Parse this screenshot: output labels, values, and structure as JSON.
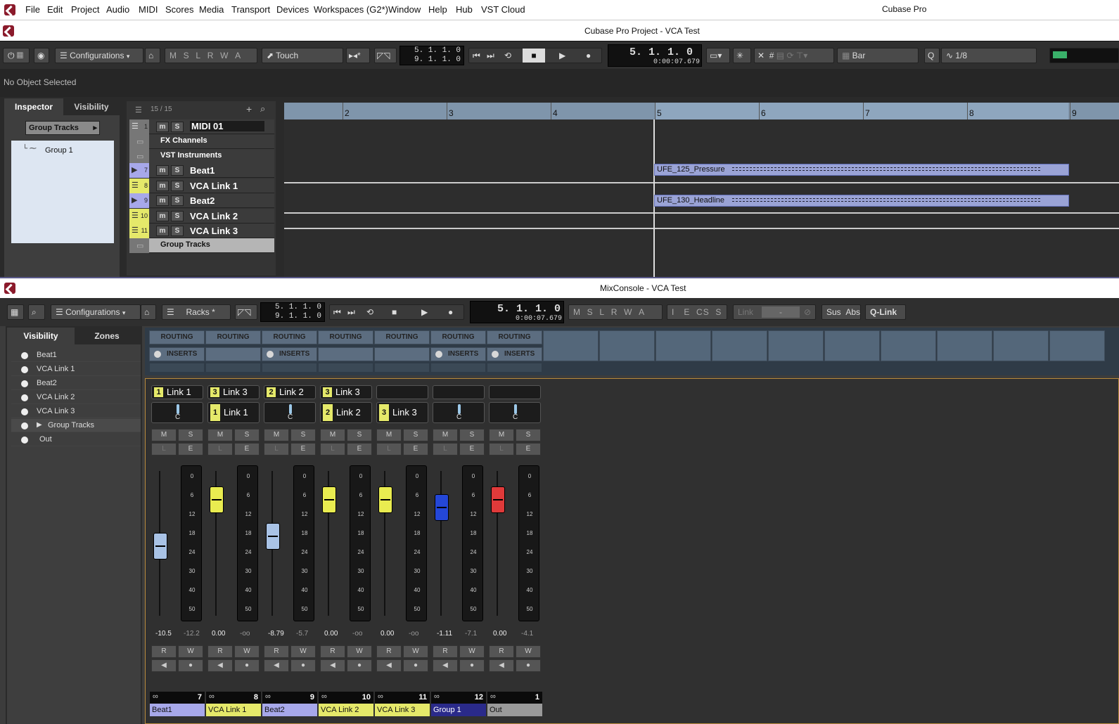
{
  "menu": {
    "items": [
      "File",
      "Edit",
      "Project",
      "Audio",
      "MIDI",
      "Scores",
      "Media",
      "Transport",
      "Devices",
      "Workspaces (G2*)",
      "Window",
      "Help",
      "Hub",
      "VST Cloud"
    ],
    "app": "Cubase Pro"
  },
  "project": {
    "title": "Cubase Pro Project - VCA Test"
  },
  "toolbar": {
    "configurations": "Configurations",
    "mslrwa": [
      "M",
      "S",
      "L",
      "R",
      "W",
      "A"
    ],
    "automation_mode": "Touch",
    "left_locator": "5. 1. 1.   0",
    "right_locator": "9. 1. 1.   0",
    "position_primary": "5.  1.  1.    0",
    "position_secondary": "0:00:07.679",
    "grid": "Bar",
    "quantize": "1/8"
  },
  "infoline": {
    "text": "No Object Selected"
  },
  "inspector": {
    "tabs": [
      "Inspector",
      "Visibility"
    ],
    "section": "Group Tracks",
    "item": "Group 1"
  },
  "tracklist": {
    "count": "15 / 15",
    "tracks": [
      {
        "num": "1",
        "name": "MIDI 01",
        "type": "midi"
      },
      {
        "num": "",
        "name": "FX Channels",
        "type": "folder"
      },
      {
        "num": "",
        "name": "VST Instruments",
        "type": "folder"
      },
      {
        "num": "7",
        "name": "Beat1",
        "type": "audio"
      },
      {
        "num": "8",
        "name": "VCA Link 1",
        "type": "vca"
      },
      {
        "num": "9",
        "name": "Beat2",
        "type": "audio"
      },
      {
        "num": "10",
        "name": "VCA Link 2",
        "type": "vca"
      },
      {
        "num": "11",
        "name": "VCA Link 3",
        "type": "vca"
      },
      {
        "num": "",
        "name": "Group Tracks",
        "type": "folder"
      }
    ]
  },
  "ruler": {
    "bars": [
      "2",
      "3",
      "4",
      "5",
      "6",
      "7",
      "8",
      "9"
    ]
  },
  "events": [
    {
      "name": "UFE_125_Pressure"
    },
    {
      "name": "UFE_130_Headline"
    }
  ],
  "mixconsole": {
    "title": "MixConsole - VCA Test",
    "configurations": "Configurations",
    "racks": "Racks",
    "left_locator": "5. 1. 1.   0",
    "right_locator": "9. 1. 1.   0",
    "position_primary": "5.  1.  1.    0",
    "position_secondary": "0:00:07.679",
    "buttons": [
      "M",
      "S",
      "L",
      "R",
      "W",
      "A"
    ],
    "buttons2": [
      "I",
      "E",
      "CS",
      "S"
    ],
    "link": "Link",
    "link_value": "-",
    "sus": "Sus",
    "abs": "Abs",
    "qlink": "Q-Link"
  },
  "visibility": {
    "tabs": [
      "Visibility",
      "Zones"
    ],
    "items": [
      "Beat1",
      "VCA Link 1",
      "Beat2",
      "VCA Link 2",
      "VCA Link 3",
      "Group Tracks",
      "Out"
    ]
  },
  "racks": {
    "routing": "ROUTING",
    "inserts": "INSERTS"
  },
  "meter_scale": [
    "0",
    "6",
    "12",
    "18",
    "24",
    "30",
    "40",
    "50"
  ],
  "channels": [
    {
      "vca1": {
        "badge": "1",
        "label": "Link 1"
      },
      "vca2": null,
      "pan": "C",
      "fader_color": "#a9c3e6",
      "fader_level": 0.52,
      "val1": "-10.5",
      "val2": "-12.2",
      "num": "7",
      "name": "Beat1",
      "color": "#a7a8ea"
    },
    {
      "vca1": {
        "badge": "3",
        "label": "Link 3"
      },
      "vca2": {
        "badge": "1",
        "label": "Link 1"
      },
      "pan": "",
      "fader_color": "#e9ec50",
      "fader_level": 0.2,
      "val1": "0.00",
      "val2": "-oo",
      "num": "8",
      "name": "VCA Link 1",
      "color": "#e5e96a"
    },
    {
      "vca1": {
        "badge": "2",
        "label": "Link 2"
      },
      "vca2": null,
      "pan": "C",
      "fader_color": "#a9c3e6",
      "fader_level": 0.45,
      "val1": "-8.79",
      "val2": "-5.7",
      "num": "9",
      "name": "Beat2",
      "color": "#a7a8ea"
    },
    {
      "vca1": {
        "badge": "3",
        "label": "Link 3"
      },
      "vca2": {
        "badge": "2",
        "label": "Link 2"
      },
      "pan": "",
      "fader_color": "#e9ec50",
      "fader_level": 0.2,
      "val1": "0.00",
      "val2": "-oo",
      "num": "10",
      "name": "VCA Link 2",
      "color": "#e5e96a"
    },
    {
      "vca1": null,
      "vca2": {
        "badge": "3",
        "label": "Link 3"
      },
      "pan": "",
      "fader_color": "#e9ec50",
      "fader_level": 0.2,
      "val1": "0.00",
      "val2": "-oo",
      "num": "11",
      "name": "VCA Link 3",
      "color": "#e5e96a"
    },
    {
      "vca1": null,
      "vca2": null,
      "pan": "C",
      "fader_color": "#2447d8",
      "fader_level": 0.25,
      "val1": "-1.11",
      "val2": "-7.1",
      "num": "12",
      "name": "Group 1",
      "color": "#2a2a8a"
    },
    {
      "vca1": null,
      "vca2": null,
      "pan": "C",
      "fader_color": "#e03a3a",
      "fader_level": 0.2,
      "val1": "0.00",
      "val2": "-4.1",
      "num": "1",
      "name": "Out",
      "color": "#9a9a9a"
    }
  ]
}
